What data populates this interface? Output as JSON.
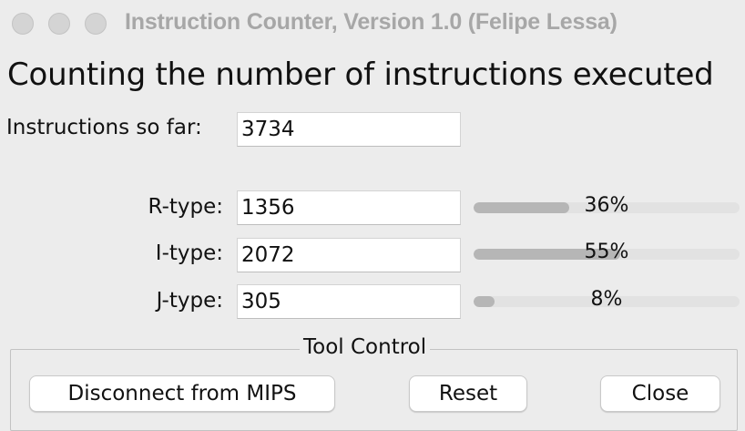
{
  "window": {
    "title": "Instruction Counter, Version 1.0 (Felipe Lessa)",
    "traffic_lights": [
      "close-button",
      "minimize-button",
      "zoom-button"
    ]
  },
  "heading": "Counting the number of instructions executed",
  "total": {
    "label": "Instructions so far:",
    "value": "3734"
  },
  "types": [
    {
      "label": "R-type:",
      "value": "1356",
      "percent_label": "36%",
      "fraction": 0.36
    },
    {
      "label": "I-type:",
      "value": "2072",
      "percent_label": "55%",
      "fraction": 0.55
    },
    {
      "label": "J-type:",
      "value": "305",
      "percent_label": "8%",
      "fraction": 0.08
    }
  ],
  "tool_control": {
    "title": "Tool Control",
    "disconnect_label": "Disconnect from MIPS",
    "reset_label": "Reset",
    "close_label": "Close"
  },
  "colors": {
    "background": "#ececec",
    "bar_fill": "#b6b6b6",
    "bar_track": "#e2e2e2",
    "title_text": "#a7a7a7"
  }
}
